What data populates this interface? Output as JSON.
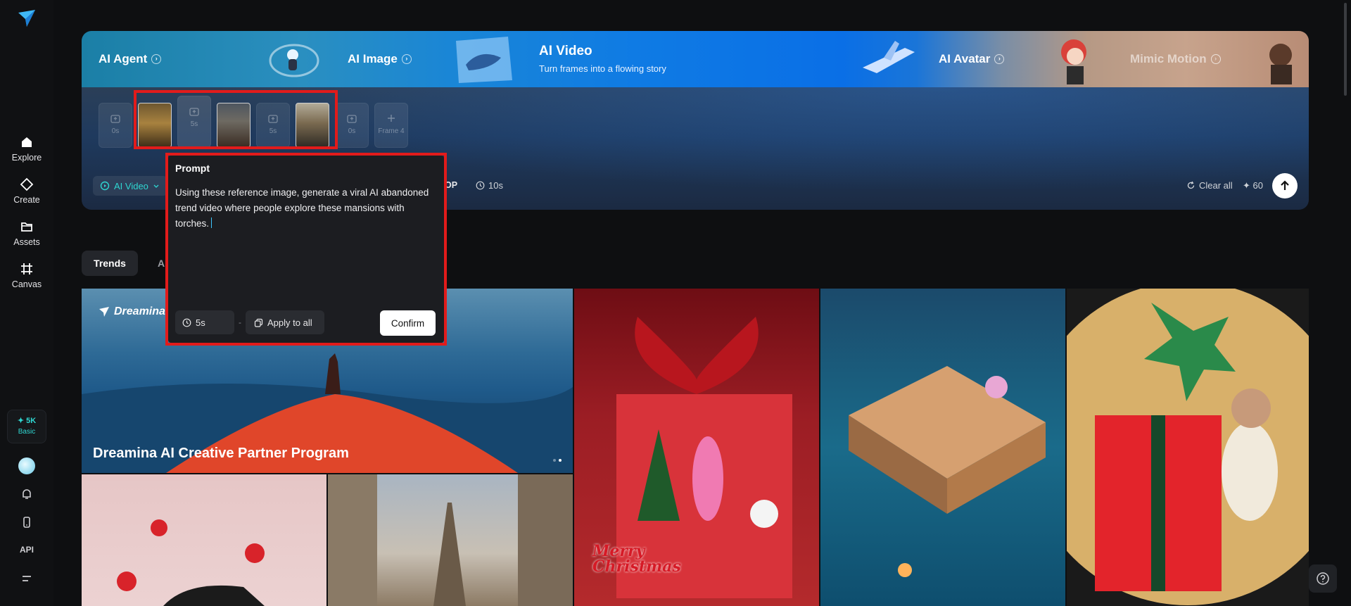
{
  "sidebar": {
    "items": [
      {
        "label": "Explore",
        "icon": "home-icon"
      },
      {
        "label": "Create",
        "icon": "diamond-icon"
      },
      {
        "label": "Assets",
        "icon": "folder-icon"
      },
      {
        "label": "Canvas",
        "icon": "frame-icon"
      }
    ],
    "credits": "✦ 5K",
    "plan": "Basic",
    "api_label": "API"
  },
  "banner": {
    "agent": "AI Agent",
    "image": "AI Image",
    "video_title": "AI Video",
    "video_subtitle": "Turn frames into a flowing story",
    "avatar": "AI Avatar",
    "mimic": "Mimic Motion"
  },
  "frames": {
    "slot1": "0s",
    "slot2": "5s",
    "slot3": "5s",
    "slot4": "0s",
    "add_label": "Frame 4"
  },
  "toolbar": {
    "mode": "AI Video",
    "option_fragment": "OP",
    "duration": "10s",
    "clear_all": "Clear all",
    "credits": "✦ 60"
  },
  "tabs": {
    "trends": "Trends",
    "second_fragment": "A"
  },
  "gallery": {
    "hero_brand": "Dreamina",
    "hero_title": "Dreamina AI Creative Partner Program",
    "xmas_text": "Merry Christmas"
  },
  "popup": {
    "title": "Prompt",
    "text": "Using these reference image, generate a viral AI abandoned trend video where people explore these mansions with torches.",
    "duration": "5s",
    "dash": "-",
    "apply_all": "Apply to all",
    "confirm": "Confirm"
  },
  "colors": {
    "accent": "#2fd6d1",
    "highlight": "#e21b1b",
    "background": "#0e0f11"
  }
}
